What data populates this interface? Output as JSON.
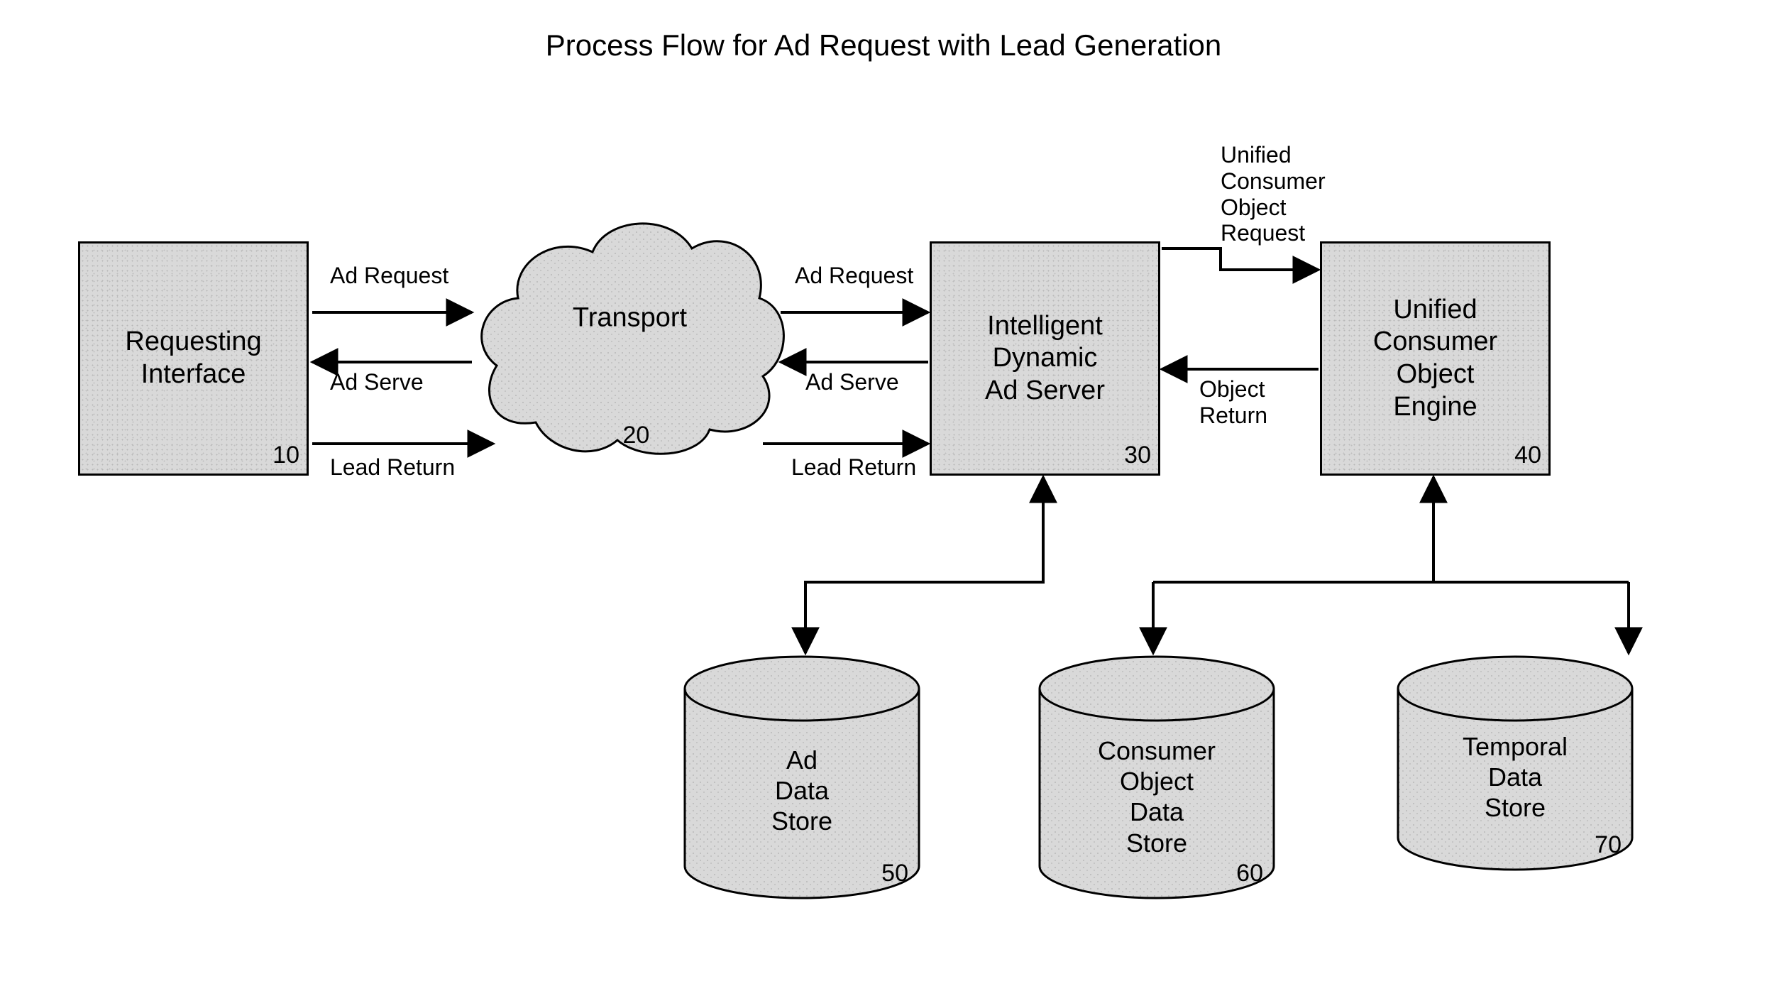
{
  "title": "Process Flow for Ad Request with Lead Generation",
  "nodes": {
    "requesting_interface": {
      "label_l1": "Requesting",
      "label_l2": "Interface",
      "num": "10"
    },
    "transport": {
      "label": "Transport",
      "num": "20"
    },
    "ad_server": {
      "label_l1": "Intelligent",
      "label_l2": "Dynamic",
      "label_l3": "Ad Server",
      "num": "30"
    },
    "uco_engine": {
      "label_l1": "Unified",
      "label_l2": "Consumer",
      "label_l3": "Object",
      "label_l4": "Engine",
      "num": "40"
    },
    "ad_store": {
      "label_l1": "Ad",
      "label_l2": "Data",
      "label_l3": "Store",
      "num": "50"
    },
    "co_store": {
      "label_l1": "Consumer",
      "label_l2": "Object",
      "label_l3": "Data",
      "label_l4": "Store",
      "num": "60"
    },
    "temporal_store": {
      "label_l1": "Temporal",
      "label_l2": "Data",
      "label_l3": "Store",
      "num": "70"
    }
  },
  "edges": {
    "ri_t_ad_request": "Ad Request",
    "ri_t_ad_serve": "Ad Serve",
    "ri_t_lead_return": "Lead Return",
    "t_s_ad_request": "Ad Request",
    "t_s_ad_serve": "Ad Serve",
    "t_s_lead_return": "Lead Return",
    "s_e_request": "Unified\nConsumer\nObject\nRequest",
    "s_e_return": "Object\nReturn"
  }
}
